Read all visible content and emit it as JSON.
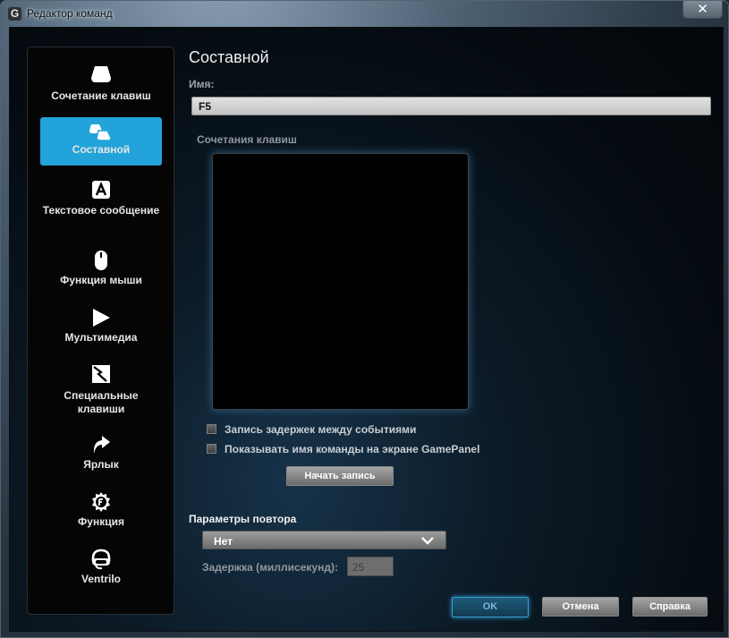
{
  "window": {
    "title": "Редактор команд",
    "close_glyph": "✕",
    "logo_glyph": "G"
  },
  "sidebar": {
    "items": [
      {
        "label": "Сочетание клавиш",
        "icon": "keyboard-key-icon",
        "active": false
      },
      {
        "label": "Составной",
        "icon": "multi-key-icon",
        "active": true
      },
      {
        "label": "Текстовое сообщение",
        "icon": "text-a-icon",
        "active": false
      },
      {
        "label": "Функция мыши",
        "icon": "mouse-icon",
        "active": false
      },
      {
        "label": "Мультимедиа",
        "icon": "play-icon",
        "active": false
      },
      {
        "label": "Специальные клавиши",
        "icon": "special-key-icon",
        "active": false
      },
      {
        "label": "Ярлык",
        "icon": "shortcut-arrow-icon",
        "active": false
      },
      {
        "label": "Функция",
        "icon": "function-gear-icon",
        "active": false
      },
      {
        "label": "Ventrilo",
        "icon": "headset-icon",
        "active": false
      }
    ],
    "active_color": "#22a3d9"
  },
  "main": {
    "title": "Составной",
    "name_label": "Имя:",
    "name_value": "F5",
    "keys_label": "Сочетания клавиш",
    "record_delays_label": "Запись задержек между событиями",
    "record_delays_checked": false,
    "show_name_label": "Показывать имя команды на экране GamePanel",
    "show_name_checked": false,
    "start_record_label": "Начать запись"
  },
  "repeat": {
    "title": "Параметры повтора",
    "selected": "Нет",
    "delay_label": "Задержка (миллисекунд):",
    "delay_value": "25"
  },
  "footer": {
    "ok_label": "OK",
    "cancel_label": "Отмена",
    "help_label": "Справка"
  }
}
